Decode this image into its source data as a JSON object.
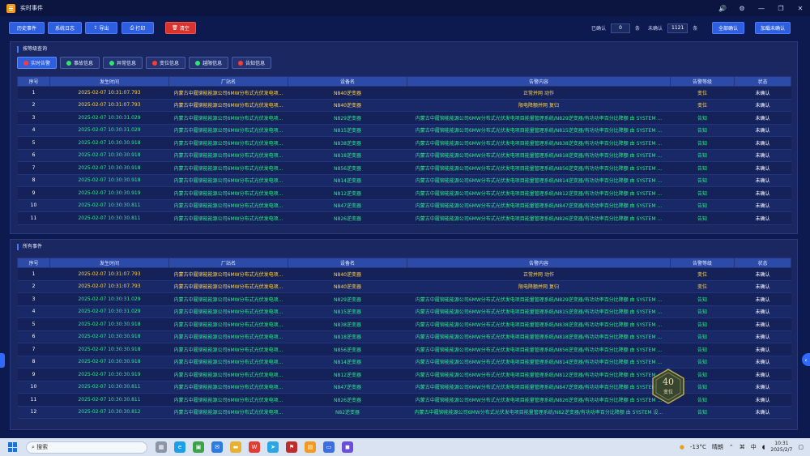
{
  "window": {
    "title": "实时事件",
    "controls": [
      "🔊",
      "⚙",
      "—",
      "❐",
      "✕"
    ]
  },
  "toolbar": {
    "buttons": [
      {
        "label": "历史事件",
        "icon": ""
      },
      {
        "label": "系统日志",
        "icon": ""
      },
      {
        "label": "导出",
        "icon": "⇪"
      },
      {
        "label": "打印",
        "icon": "⎙"
      },
      {
        "label": "清空",
        "icon": "🗑"
      }
    ],
    "confirmed_label": "已确认",
    "confirmed_count": "0",
    "unit1": "条",
    "unconfirmed_label": "未确认",
    "unconfirmed_count": "1121",
    "unit2": "条",
    "confirm_all": "全部确认",
    "load_unconfirmed": "加载未确认"
  },
  "panel1": {
    "title": "按等级查询",
    "filters": [
      {
        "label": "实时告警",
        "color": "#ff3b30"
      },
      {
        "label": "事故信息",
        "color": "#2ee66a"
      },
      {
        "label": "异常信息",
        "color": "#2ee66a"
      },
      {
        "label": "变位信息",
        "color": "#ff3b30"
      },
      {
        "label": "越限信息",
        "color": "#2ee66a"
      },
      {
        "label": "告知信息",
        "color": "#ff3b30"
      }
    ]
  },
  "panel2": {
    "title": "所有事件"
  },
  "table": {
    "headers": [
      "序号",
      "发生时间",
      "厂站名",
      "设备名",
      "告警内容",
      "告警等级",
      "状态"
    ],
    "rows": [
      {
        "c": [
          "1",
          "2025-02-07 10:31:07.793",
          "内蒙古中履铆能能源公司6MW分布式光伏发电项...",
          "N840逆变器",
          "正常并网 动作",
          "变位",
          "未确认"
        ],
        "t": "y"
      },
      {
        "c": [
          "2",
          "2025-02-07 10:31:07.793",
          "内蒙古中履铆能能源公司6MW分布式光伏发电项...",
          "N840逆变器",
          "限电降额并网 复归",
          "变位",
          "未确认"
        ],
        "t": "y"
      },
      {
        "c": [
          "3",
          "2025-02-07 10:30:31.029",
          "内蒙古中履铆能能源公司6MW分布式光伏发电项...",
          "N829逆变器",
          "内蒙古中履铆能能源公司6MW分布式光伏发电项目能量管理系统/N829逆变器/有功功率百分比降额 由 SYSTEM ...",
          "告知",
          "未确认"
        ],
        "t": "g"
      },
      {
        "c": [
          "4",
          "2025-02-07 10:30:31.029",
          "内蒙古中履铆能能源公司6MW分布式光伏发电项...",
          "N815逆变器",
          "内蒙古中履铆能能源公司6MW分布式光伏发电项目能量管理系统/N815逆变器/有功功率百分比降额 由 SYSTEM ...",
          "告知",
          "未确认"
        ],
        "t": "g"
      },
      {
        "c": [
          "5",
          "2025-02-07 10:30:30.918",
          "内蒙古中履铆能能源公司6MW分布式光伏发电项...",
          "N838逆变器",
          "内蒙古中履铆能能源公司6MW分布式光伏发电项目能量管理系统/N838逆变器/有功功率百分比降额 由 SYSTEM ...",
          "告知",
          "未确认"
        ],
        "t": "g"
      },
      {
        "c": [
          "6",
          "2025-02-07 10:30:30.918",
          "内蒙古中履铆能能源公司6MW分布式光伏发电项...",
          "N818逆变器",
          "内蒙古中履铆能能源公司6MW分布式光伏发电项目能量管理系统/N818逆变器/有功功率百分比降额 由 SYSTEM ...",
          "告知",
          "未确认"
        ],
        "t": "g"
      },
      {
        "c": [
          "7",
          "2025-02-07 10:30:30.918",
          "内蒙古中履铆能能源公司6MW分布式光伏发电项...",
          "N856逆变器",
          "内蒙古中履铆能能源公司6MW分布式光伏发电项目能量管理系统/N856逆变器/有功功率百分比降额 由 SYSTEM ...",
          "告知",
          "未确认"
        ],
        "t": "g"
      },
      {
        "c": [
          "8",
          "2025-02-07 10:30:30.918",
          "内蒙古中履铆能能源公司6MW分布式光伏发电项...",
          "N814逆变器",
          "内蒙古中履铆能能源公司6MW分布式光伏发电项目能量管理系统/N814逆变器/有功功率百分比降额 由 SYSTEM ...",
          "告知",
          "未确认"
        ],
        "t": "g"
      },
      {
        "c": [
          "9",
          "2025-02-07 10:30:30.919",
          "内蒙古中履铆能能源公司6MW分布式光伏发电项...",
          "N812逆变器",
          "内蒙古中履铆能能源公司6MW分布式光伏发电项目能量管理系统/N812逆变器/有功功率百分比降额 由 SYSTEM ...",
          "告知",
          "未确认"
        ],
        "t": "g"
      },
      {
        "c": [
          "10",
          "2025-02-07 10:30:30.811",
          "内蒙古中履铆能能源公司6MW分布式光伏发电项...",
          "N847逆变器",
          "内蒙古中履铆能能源公司6MW分布式光伏发电项目能量管理系统/N847逆变器/有功功率百分比降额 由 SYSTEM ...",
          "告知",
          "未确认"
        ],
        "t": "g"
      },
      {
        "c": [
          "11",
          "2025-02-07 10:30:30.811",
          "内蒙古中履铆能能源公司6MW分布式光伏发电项...",
          "N826逆变器",
          "内蒙古中履铆能能源公司6MW分布式光伏发电项目能量管理系统/N826逆变器/有功功率百分比降额 由 SYSTEM ...",
          "告知",
          "未确认"
        ],
        "t": "g"
      },
      {
        "c": [
          "12",
          "2025-02-07 10:30:30.812",
          "内蒙古中履铆能能源公司6MW分布式光伏发电项...",
          "N82逆变器",
          "内蒙古中履铆能能源公司6MW分布式光伏发电项目能量管理系统/N82逆变器/有功功率百分比降额 由 SYSTEM 设...",
          "告知",
          "未确认"
        ],
        "t": "g"
      }
    ]
  },
  "badge": {
    "count": "40",
    "label": "变位"
  },
  "taskbar": {
    "search": "搜索",
    "weather": "-13°C",
    "weather_text": "晴朗",
    "ime": "中",
    "time": "10:31",
    "date": "2025/2/7"
  },
  "colors": {
    "bg": "#0d1a4f",
    "accent": "#2e5fe0",
    "warn": "#ffd24a",
    "ok": "#2ee88a",
    "danger": "#d9332f"
  }
}
